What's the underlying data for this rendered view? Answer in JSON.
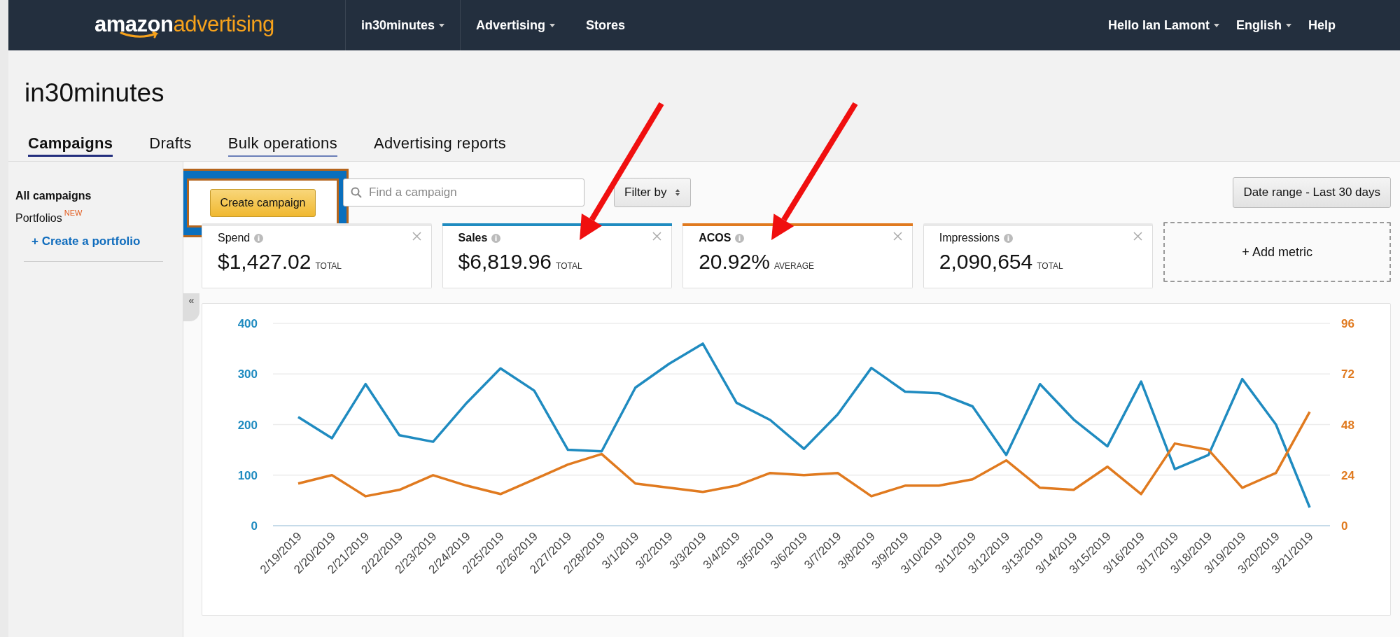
{
  "nav": {
    "logo": {
      "word": "amazon",
      "accent": "advertising"
    },
    "items": [
      {
        "label": "in30minutes",
        "dropdown": true
      },
      {
        "label": "Advertising",
        "dropdown": true
      },
      {
        "label": "Stores",
        "dropdown": false
      }
    ],
    "right_items": [
      {
        "label": "Hello Ian Lamont",
        "dropdown": true
      },
      {
        "label": "English",
        "dropdown": true
      },
      {
        "label": "Help",
        "dropdown": false
      }
    ]
  },
  "page_title": "in30minutes",
  "tabs": [
    {
      "label": "Campaigns",
      "selected": true,
      "hovered": false
    },
    {
      "label": "Drafts",
      "selected": false,
      "hovered": false
    },
    {
      "label": "Bulk operations",
      "selected": false,
      "hovered": true
    },
    {
      "label": "Advertising reports",
      "selected": false,
      "hovered": false
    }
  ],
  "sidebar": {
    "items": [
      {
        "label": "All campaigns",
        "selected": true
      },
      {
        "label": "Portfolios",
        "badge": "NEW",
        "selected": false
      }
    ],
    "link": "+ Create a portfolio",
    "collapse": "«"
  },
  "toolbar": {
    "create_button": "Create campaign",
    "highlighted": true,
    "search": {
      "placeholder": "Find a campaign"
    },
    "filter": "Filter by",
    "date_range": "Date range - Last 30 days"
  },
  "metrics": [
    {
      "name": "Spend",
      "value": "$1,427.02",
      "unit": "TOTAL",
      "selected": false
    },
    {
      "name": "Sales",
      "value": "$6,819.96",
      "unit": "TOTAL",
      "selected": true,
      "color": "#1f8bc0"
    },
    {
      "name": "ACOS",
      "value": "20.92%",
      "unit": "AVERAGE",
      "selected": true,
      "color": "#e07a1f"
    },
    {
      "name": "Impressions",
      "value": "2,090,654",
      "unit": "TOTAL",
      "selected": false
    }
  ],
  "add_metric": "+ Add metric",
  "chart": {
    "chart_data": {
      "type": "line",
      "grid": true,
      "categories": [
        "2/19/2019",
        "2/20/2019",
        "2/21/2019",
        "2/22/2019",
        "2/23/2019",
        "2/24/2019",
        "2/25/2019",
        "2/26/2019",
        "2/27/2019",
        "2/28/2019",
        "3/1/2019",
        "3/2/2019",
        "3/3/2019",
        "3/4/2019",
        "3/5/2019",
        "3/6/2019",
        "3/7/2019",
        "3/8/2019",
        "3/9/2019",
        "3/10/2019",
        "3/11/2019",
        "3/12/2019",
        "3/13/2019",
        "3/14/2019",
        "3/15/2019",
        "3/16/2019",
        "3/17/2019",
        "3/18/2019",
        "3/19/2019",
        "3/20/2019",
        "3/21/2019"
      ],
      "ylim": [
        0,
        400
      ],
      "yticks": [
        0,
        100,
        200,
        300,
        400
      ],
      "y2lim": [
        0,
        96
      ],
      "y2ticks": [
        0,
        24,
        48,
        72,
        96
      ],
      "series": [
        {
          "color": "#1f8bc0",
          "values": [
            215,
            173,
            280,
            179,
            166,
            243,
            311,
            267,
            150,
            147,
            273,
            320,
            360,
            243,
            209,
            152,
            220,
            312,
            265,
            262,
            236,
            140,
            280,
            210,
            157,
            285,
            112,
            140,
            290,
            200,
            36
          ]
        },
        {
          "color": "#e07a1f",
          "axis": "y2",
          "values": [
            20,
            24,
            14,
            17,
            24,
            19,
            15,
            22,
            29,
            34,
            20,
            18,
            16,
            19,
            25,
            24,
            25,
            14,
            19,
            19,
            22,
            31,
            18,
            17,
            28,
            15,
            39,
            36,
            18,
            25,
            54
          ]
        }
      ]
    }
  },
  "annotations": [
    {
      "kind": "arrow"
    },
    {
      "kind": "arrow"
    }
  ]
}
